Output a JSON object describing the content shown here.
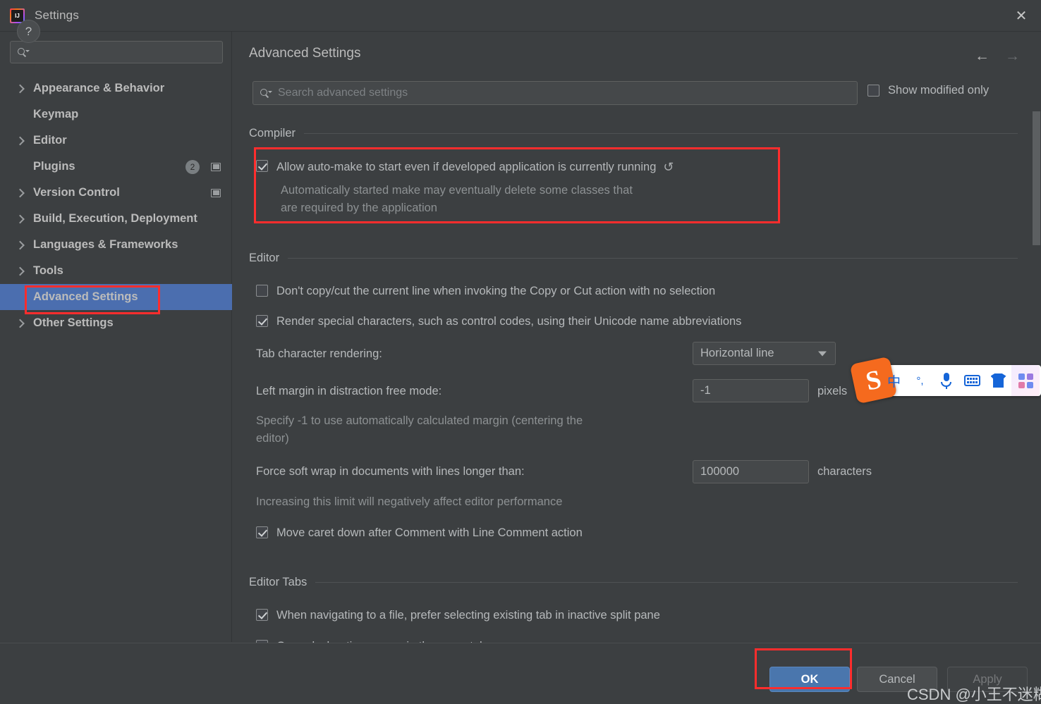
{
  "window": {
    "title": "Settings",
    "app_icon": "intellij-idea-logo",
    "close_label": "✕"
  },
  "sidebar": {
    "search_placeholder": "",
    "items": [
      {
        "label": "Appearance & Behavior",
        "expandable": true,
        "selected": false
      },
      {
        "label": "Keymap",
        "expandable": false,
        "selected": false
      },
      {
        "label": "Editor",
        "expandable": true,
        "selected": false
      },
      {
        "label": "Plugins",
        "expandable": false,
        "selected": false,
        "badge": "2",
        "window_icon": true
      },
      {
        "label": "Version Control",
        "expandable": true,
        "selected": false,
        "window_icon": true
      },
      {
        "label": "Build, Execution, Deployment",
        "expandable": true,
        "selected": false
      },
      {
        "label": "Languages & Frameworks",
        "expandable": true,
        "selected": false
      },
      {
        "label": "Tools",
        "expandable": true,
        "selected": false
      },
      {
        "label": "Advanced Settings",
        "expandable": false,
        "selected": true
      },
      {
        "label": "Other Settings",
        "expandable": true,
        "selected": false
      }
    ]
  },
  "main": {
    "title": "Advanced Settings",
    "nav": {
      "back": "←",
      "forward": "→"
    },
    "search": {
      "placeholder": "Search advanced settings",
      "value": ""
    },
    "show_modified_only": {
      "label": "Show modified only",
      "checked": false
    },
    "sections": [
      {
        "title": "Compiler"
      },
      {
        "title": "Editor"
      },
      {
        "title": "Editor Tabs"
      }
    ],
    "compiler": {
      "auto_make": {
        "label": "Allow auto-make to start even if developed application is currently running",
        "checked": true,
        "revert_icon": "↺",
        "description_line1": "Automatically started make may eventually delete some classes that",
        "description_line2": "are required by the application"
      }
    },
    "editor": {
      "dont_copy_cut": {
        "label": "Don't copy/cut the current line when invoking the Copy or Cut action with no selection",
        "checked": false
      },
      "render_special_chars": {
        "label": "Render special characters, such as control codes, using their Unicode name abbreviations",
        "checked": true
      },
      "tab_char_rendering": {
        "label": "Tab character rendering:",
        "value": "Horizontal line"
      },
      "left_margin": {
        "label": "Left margin in distraction free mode:",
        "value": "-1",
        "unit": "pixels",
        "description_line1": "Specify -1 to use automatically calculated margin (centering the",
        "description_line2": "editor)"
      },
      "force_soft_wrap": {
        "label": "Force soft wrap in documents with lines longer than:",
        "value": "100000",
        "unit": "characters",
        "description": "Increasing this limit will negatively affect editor performance"
      },
      "move_caret_down": {
        "label": "Move caret down after Comment with Line Comment action",
        "checked": true
      }
    },
    "editor_tabs": {
      "prefer_existing_tab": {
        "label": "When navigating to a file, prefer selecting existing tab in inactive split pane",
        "checked": true
      },
      "open_declaration_same_tab": {
        "label": "Open declaration source in the same tab",
        "checked": false
      }
    }
  },
  "footer": {
    "help_label": "?",
    "ok_label": "OK",
    "cancel_label": "Cancel",
    "apply_label": "Apply"
  },
  "ime_toolbar": {
    "logo_text": "S",
    "items": [
      {
        "name": "chinese-mode",
        "glyph": "中"
      },
      {
        "name": "punctuation-mode",
        "glyph": "°,"
      },
      {
        "name": "voice-input",
        "glyph": ""
      },
      {
        "name": "soft-keyboard",
        "glyph": ""
      },
      {
        "name": "skin",
        "glyph": ""
      },
      {
        "name": "toolbox",
        "glyph": ""
      }
    ]
  },
  "watermark": {
    "text": "CSDN @小王不迷糊"
  },
  "colors": {
    "window_bg": "#3c3f41",
    "selection_blue": "#4b6eaf",
    "annotation_red": "#ff2d2d",
    "ok_button_blue": "#4a76ad",
    "ime_orange": "#f56a1e",
    "ime_blue": "#1565d8"
  }
}
